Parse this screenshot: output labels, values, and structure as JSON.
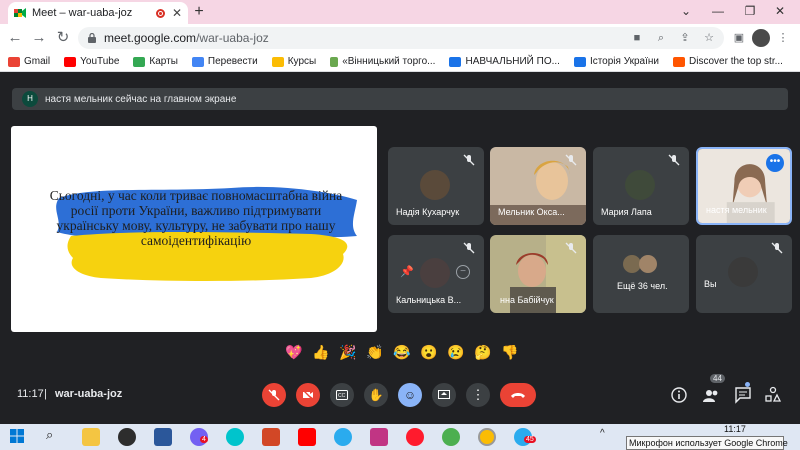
{
  "browser": {
    "tab_title": "Meet – war-uaba-joz",
    "new_tab": "+",
    "url_domain": "meet.google.com",
    "url_path": "/war-uaba-joz",
    "bookmarks": [
      {
        "label": "Gmail",
        "color": "#ea4335"
      },
      {
        "label": "YouTube",
        "color": "#ff0000"
      },
      {
        "label": "Карты",
        "color": "#34a853"
      },
      {
        "label": "Перевести",
        "color": "#4285f4"
      },
      {
        "label": "Курсы",
        "color": "#fbbc04"
      },
      {
        "label": "«Вінницький торго...",
        "color": "#6aa84f"
      },
      {
        "label": "НАВЧАЛЬНИЙ ПО...",
        "color": "#1a73e8"
      },
      {
        "label": "Історія України",
        "color": "#1a73e8"
      },
      {
        "label": "Discover the top str...",
        "color": "#ff5500"
      }
    ]
  },
  "meet": {
    "banner_avatar": "Н",
    "banner_text": "настя мельник сейчас на главном экране",
    "presentation_text": "Сьогодні, у час коли триває повномасштабна війна росії проти України, важливо підтримувати українську мову, культуру, не забувати про нашу самоідентифікацію",
    "participants": [
      {
        "name": "Надія Кухарчук"
      },
      {
        "name": "Мельник Окса..."
      },
      {
        "name": "Мария Лапа"
      },
      {
        "name": "настя мельник"
      },
      {
        "name": "Кальницька В..."
      },
      {
        "name": "нна Бабійчук"
      },
      {
        "name": "Ещё 36 чел."
      },
      {
        "name": "Вы"
      }
    ],
    "reactions": [
      "💖",
      "👍",
      "🎉",
      "👏",
      "😂",
      "😮",
      "😢",
      "🤔",
      "👎"
    ],
    "time": "11:17",
    "separator": "|",
    "meeting_code": "war-uaba-joz",
    "participant_count": "44"
  },
  "taskbar": {
    "tooltip": "Микрофон использует Google Chrome",
    "clock": "11:17",
    "badge_viber": "4",
    "badge_telegram": "45"
  }
}
